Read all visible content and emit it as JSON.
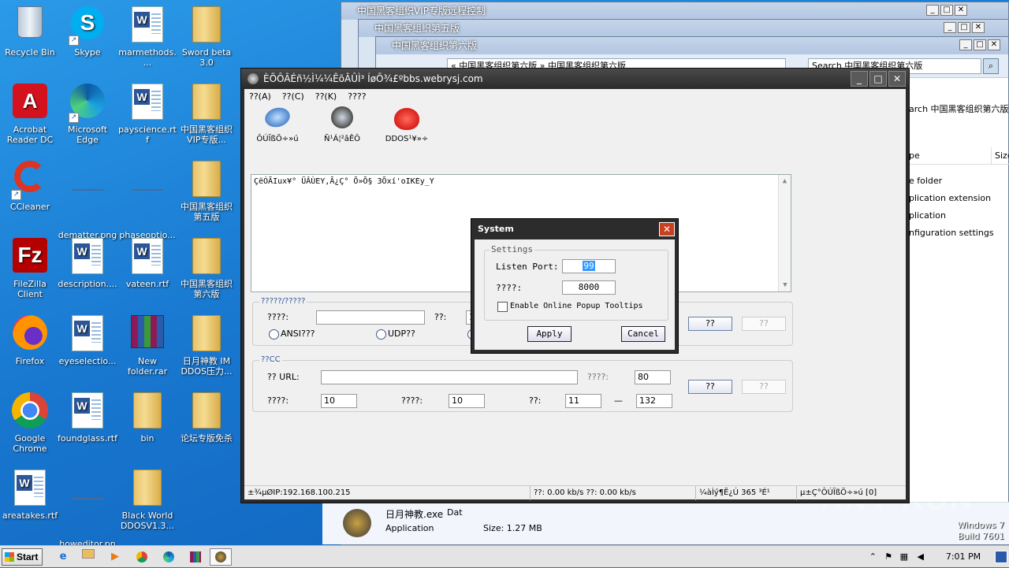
{
  "desktop": {
    "icons_col1": [
      {
        "label": "Recycle Bin",
        "icon": "recycle-bin-icon"
      },
      {
        "label": "Acrobat Reader DC",
        "icon": "acrobat-icon"
      },
      {
        "label": "CCleaner",
        "icon": "ccleaner-icon"
      },
      {
        "label": "FileZilla Client",
        "icon": "filezilla-icon"
      },
      {
        "label": "Firefox",
        "icon": "firefox-icon"
      },
      {
        "label": "Google Chrome",
        "icon": "chrome-icon"
      },
      {
        "label": "areatakes.rtf",
        "icon": "word-doc-icon"
      }
    ],
    "icons_col2": [
      {
        "label": "Skype",
        "icon": "skype-icon"
      },
      {
        "label": "Microsoft Edge",
        "icon": "edge-icon"
      },
      {
        "label": "dematter.png",
        "icon": "image-icon"
      },
      {
        "label": "description....",
        "icon": "word-doc-icon"
      },
      {
        "label": "eyeselectio...",
        "icon": "word-doc-icon"
      },
      {
        "label": "foundglass.rtf",
        "icon": "word-doc-icon"
      },
      {
        "label": "howeditor.png",
        "icon": "image-icon"
      }
    ],
    "icons_col3": [
      {
        "label": "marmethods....",
        "icon": "word-doc-icon"
      },
      {
        "label": "payscience.rtf",
        "icon": "word-doc-icon"
      },
      {
        "label": "phaseoptio...",
        "icon": "image-icon"
      },
      {
        "label": "vateen.rtf",
        "icon": "word-doc-icon"
      },
      {
        "label": "New folder.rar",
        "icon": "winrar-icon"
      },
      {
        "label": "bin",
        "icon": "folder-icon"
      },
      {
        "label": "Black World DDOSV1.3...",
        "icon": "folder-icon"
      }
    ],
    "icons_col4": [
      {
        "label": "Sword beta 3.0",
        "icon": "folder-icon"
      },
      {
        "label": "中国黑客组织VIP专版...",
        "icon": "folder-icon"
      },
      {
        "label": "中国黑客组织第五版",
        "icon": "folder-icon"
      },
      {
        "label": "中国黑客组织第六版",
        "icon": "folder-icon"
      },
      {
        "label": "日月神教 IM DDOS压力...",
        "icon": "folder-icon"
      },
      {
        "label": "论坛专版免杀",
        "icon": "folder-icon"
      }
    ]
  },
  "explorer": {
    "win1_title": "中国黑客组织VIP专版远程控制",
    "win2_title": "中国黑客组织第五版",
    "win3_title": "中国黑客组织第六版",
    "path": "« 中国黑客组织第六版 » 中国黑客组织第六版",
    "search_placeholder": "Search 中国黑客组织第六版",
    "search_partial": "arch 中国黑客组织第六版",
    "col_type": "pe",
    "col_size": "Size",
    "type_items": [
      "e folder",
      "plication extension",
      "plication",
      "nfiguration settings"
    ],
    "details_name": "日月神教.exe",
    "details_date_label": "Dat",
    "details_kind": "Application",
    "details_size": "Size: 1.27 MB"
  },
  "app": {
    "title": "ÈÕÔÂÉñ½Ì¼¼ÊõÂÛÌ³   ÍøÕ¾£ºbbs.webrysj.com",
    "menu": [
      "??(A)",
      "??(C)",
      "??(K)",
      "????"
    ],
    "toolbar": [
      {
        "label": "ÔÚÏßÖ÷»ú",
        "icon": "network-computer-icon"
      },
      {
        "label": "Ñ¹Á¦²âÊÔ",
        "icon": "radar-icon"
      },
      {
        "label": "DDOS¹¥»÷",
        "icon": "devil-icon"
      }
    ],
    "log_text": "ÇëÓÃIux¥° ÜÂÙEY,Ã¿Ç° Õ»Õ§ 3Õxí'oIKEy_Y",
    "group1": {
      "label": "?????/?????",
      "field1_label": "????:",
      "field1_value": "",
      "field2_label": "??:",
      "field2_value": "1",
      "radio1": "ANSI???",
      "radio2": "UDP??",
      "btn_start": "??",
      "btn_stop": "??"
    },
    "group2": {
      "label": "??CC",
      "url_label": "?? URL:",
      "url_value": "",
      "port_label": "????:",
      "port_value": "80",
      "row2_label1": "????:",
      "row2_value1": "10",
      "row2_label2": "????:",
      "row2_value2": "10",
      "row2_label3": "??:",
      "row2_value3": "11",
      "row2_dash": "—",
      "row2_value4": "132",
      "btn_start": "??",
      "btn_stop": "??"
    },
    "status": {
      "ip": "±¾µØIP:192.168.100.215",
      "speed": "??: 0.00 kb/s ??: 0.00 kb/s",
      "days": "¼àÌý¶Ë¿Ú 365 ³É¹",
      "online": "µ±Ç°ÔÚÏßÖ÷»ú [0]"
    }
  },
  "dialog": {
    "title": "System",
    "group_label": "Settings",
    "listen_port_label": "Listen Port:",
    "listen_port_value": "99",
    "field2_label": "????:",
    "field2_value": "8000",
    "checkbox_label": "Enable Online Popup Tooltips",
    "checkbox_checked": false,
    "apply": "Apply",
    "cancel": "Cancel"
  },
  "taskbar": {
    "start": "Start",
    "clock": "7:01 PM",
    "watermark_os": "Windows 7",
    "watermark_build": "Build 7601",
    "watermark_brand": "ANY RUN"
  }
}
